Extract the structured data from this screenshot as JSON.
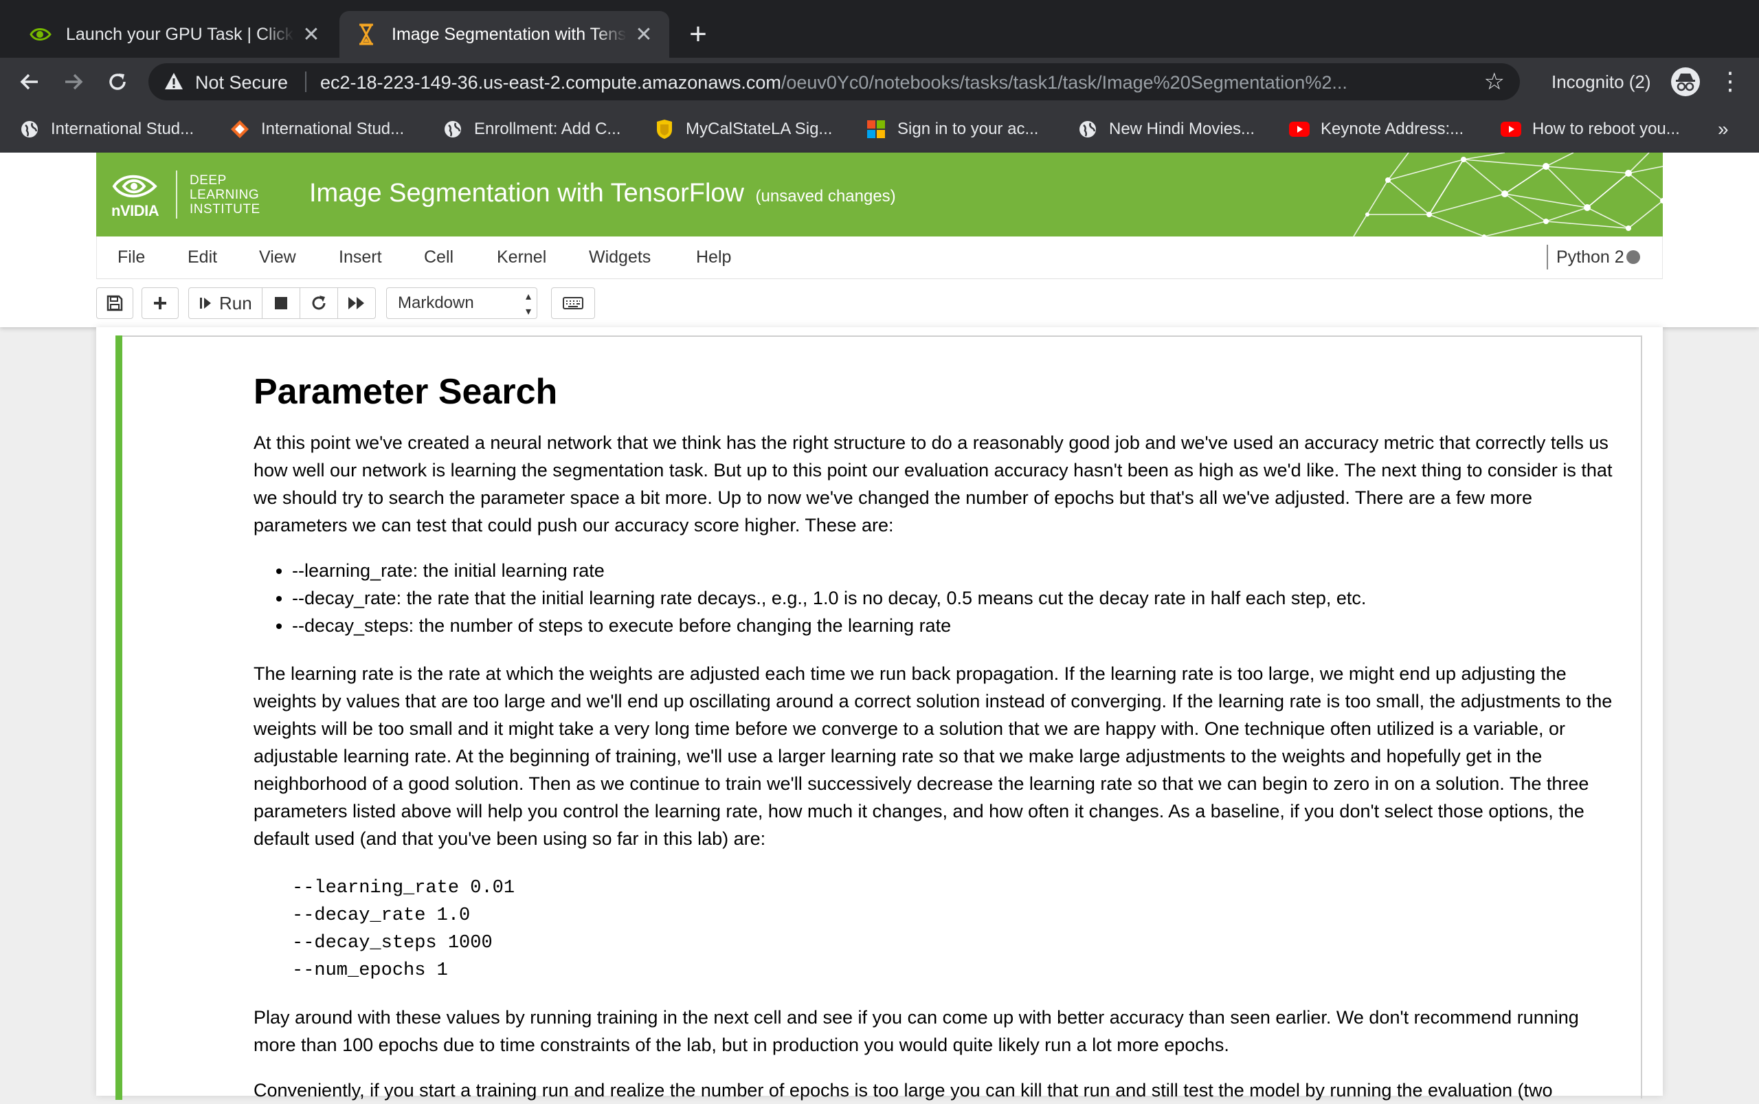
{
  "browser": {
    "tabs": [
      {
        "title": "Launch your GPU Task | Click h",
        "icon": "nvidia-icon",
        "active": false
      },
      {
        "title": "Image Segmentation with Tens",
        "icon": "hourglass-icon",
        "active": true
      }
    ],
    "security_label": "Not Secure",
    "url_host": "ec2-18-223-149-36.us-east-2.compute.amazonaws.com",
    "url_path": "/oeuv0Yc0/notebooks/tasks/task1/task/Image%20Segmentation%2...",
    "incognito_label": "Incognito (2)",
    "bookmarks": [
      {
        "label": "International Stud...",
        "icon": "globe-icon"
      },
      {
        "label": "International Stud...",
        "icon": "diamond-logo-icon"
      },
      {
        "label": "Enrollment: Add C...",
        "icon": "globe-icon"
      },
      {
        "label": "MyCalStateLA Sig...",
        "icon": "shield-logo-icon"
      },
      {
        "label": "Sign in to your ac...",
        "icon": "microsoft-icon"
      },
      {
        "label": "New Hindi Movies...",
        "icon": "globe-icon"
      },
      {
        "label": "Keynote Address:...",
        "icon": "youtube-icon"
      },
      {
        "label": "How to reboot you...",
        "icon": "youtube-icon"
      }
    ],
    "bookmarks_overflow": "»"
  },
  "jupyter": {
    "brand": {
      "nvidia": "nVIDIA",
      "dli_line1": "DEEP",
      "dli_line2": "LEARNING",
      "dli_line3": "INSTITUTE"
    },
    "notebook_title": "Image Segmentation with TensorFlow",
    "unsaved": "(unsaved changes)",
    "menu": [
      "File",
      "Edit",
      "View",
      "Insert",
      "Cell",
      "Kernel",
      "Widgets",
      "Help"
    ],
    "kernel_name": "Python 2",
    "run_label": "Run",
    "cell_type": "Markdown"
  },
  "cell": {
    "heading": "Parameter Search",
    "para1": "At this point we've created a neural network that we think has the right structure to do a reasonably good job and we've used an accuracy metric that correctly tells us how well our network is learning the segmentation task. But up to this point our evaluation accuracy hasn't been as high as we'd like. The next thing to consider is that we should try to search the parameter space a bit more. Up to now we've changed the number of epochs but that's all we've adjusted. There are a few more parameters we can test that could push our accuracy score higher. These are:",
    "bullets": [
      "--learning_rate: the initial learning rate",
      "--decay_rate: the rate that the initial learning rate decays., e.g., 1.0 is no decay, 0.5 means cut the decay rate in half each step, etc.",
      "--decay_steps: the number of steps to execute before changing the learning rate"
    ],
    "para2": "The learning rate is the rate at which the weights are adjusted each time we run back propagation. If the learning rate is too large, we might end up adjusting the weights by values that are too large and we'll end up oscillating around a correct solution instead of converging. If the learning rate is too small, the adjustments to the weights will be too small and it might take a very long time before we converge to a solution that we are happy with. One technique often utilized is a variable, or adjustable learning rate. At the beginning of training, we'll use a larger learning rate so that we make large adjustments to the weights and hopefully get in the neighborhood of a good solution. Then as we continue to train we'll successively decrease the learning rate so that we can begin to zero in on a solution. The three parameters listed above will help you control the learning rate, how much it changes, and how often it changes. As a baseline, if you don't select those options, the default used (and that you've been using so far in this lab) are:",
    "code_lines": [
      "--learning_rate 0.01",
      "--decay_rate 1.0",
      "--decay_steps 1000",
      "--num_epochs 1"
    ],
    "para3": "Play around with these values by running training in the next cell and see if you can come up with better accuracy than seen earlier. We don't recommend running more than 100 epochs due to time constraints of the lab, but in production you would quite likely run a lot more epochs.",
    "para4": "Conveniently, if you start a training run and realize the number of epochs is too large you can kill that run and still test the model by running the evaluation (two"
  },
  "colors": {
    "nvidia_green": "#76b43c",
    "cell_bar": "#66bb3b",
    "chrome_dark": "#202124",
    "chrome_mid": "#35363a"
  }
}
